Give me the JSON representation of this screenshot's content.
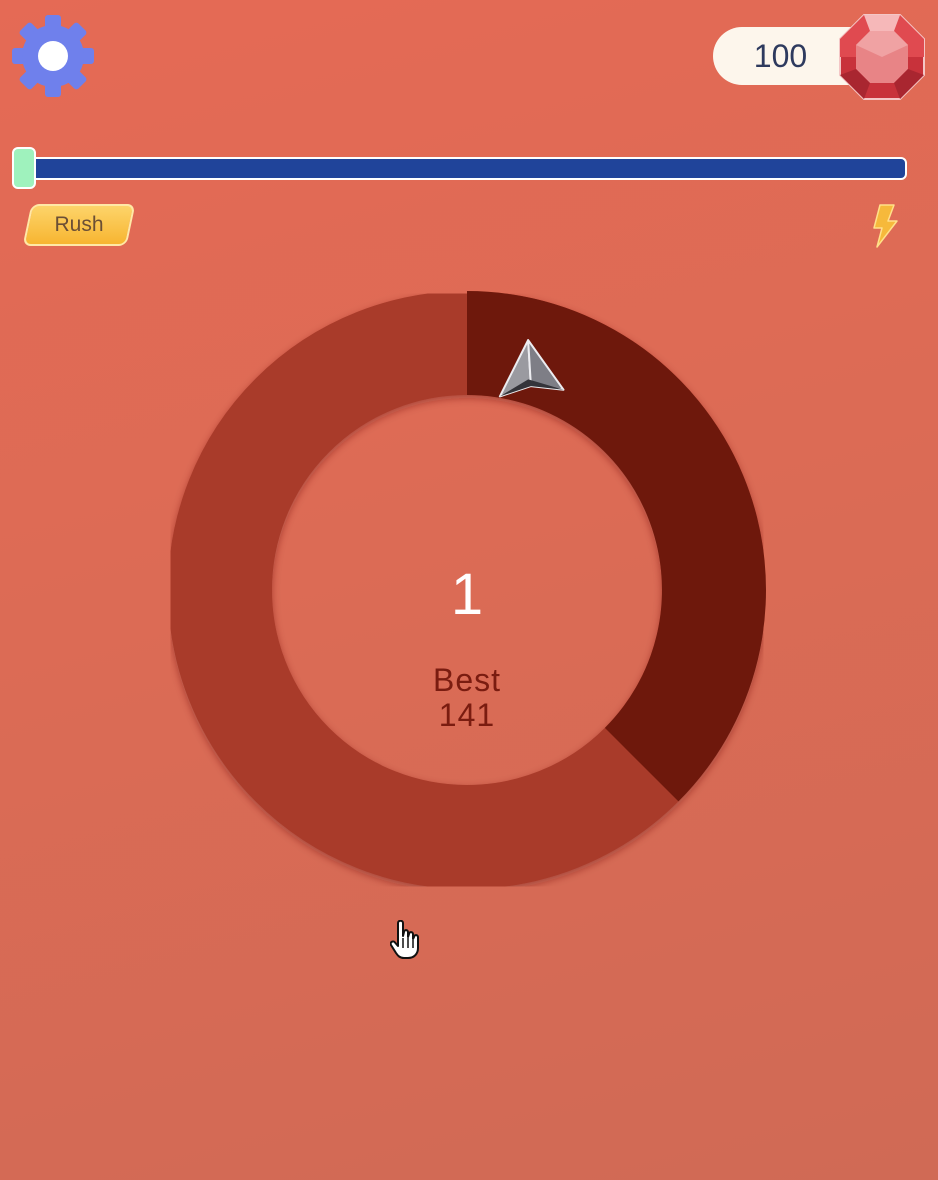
{
  "header": {
    "settings_icon": "gear-icon",
    "gems": {
      "count": "100",
      "icon": "ruby-gem-icon"
    }
  },
  "progress": {
    "fraction": 0.01
  },
  "mode": {
    "rush_label": "Rush",
    "bolt_icon": "lightning-bolt-icon"
  },
  "game": {
    "score": "1",
    "best_label": "Best",
    "best_value": "141",
    "player_icon": "paper-plane-icon",
    "target_arc_start_deg": 0,
    "target_arc_end_deg": 135
  },
  "colors": {
    "background": "#dc6b55",
    "ring": "#a93a29",
    "target_arc": "#6e180c",
    "progress_track": "#20449a",
    "progress_fill": "#9af0bf",
    "gear": "#6f80ec",
    "gem": "#d43a42",
    "rush_button": "#f9c24a"
  }
}
